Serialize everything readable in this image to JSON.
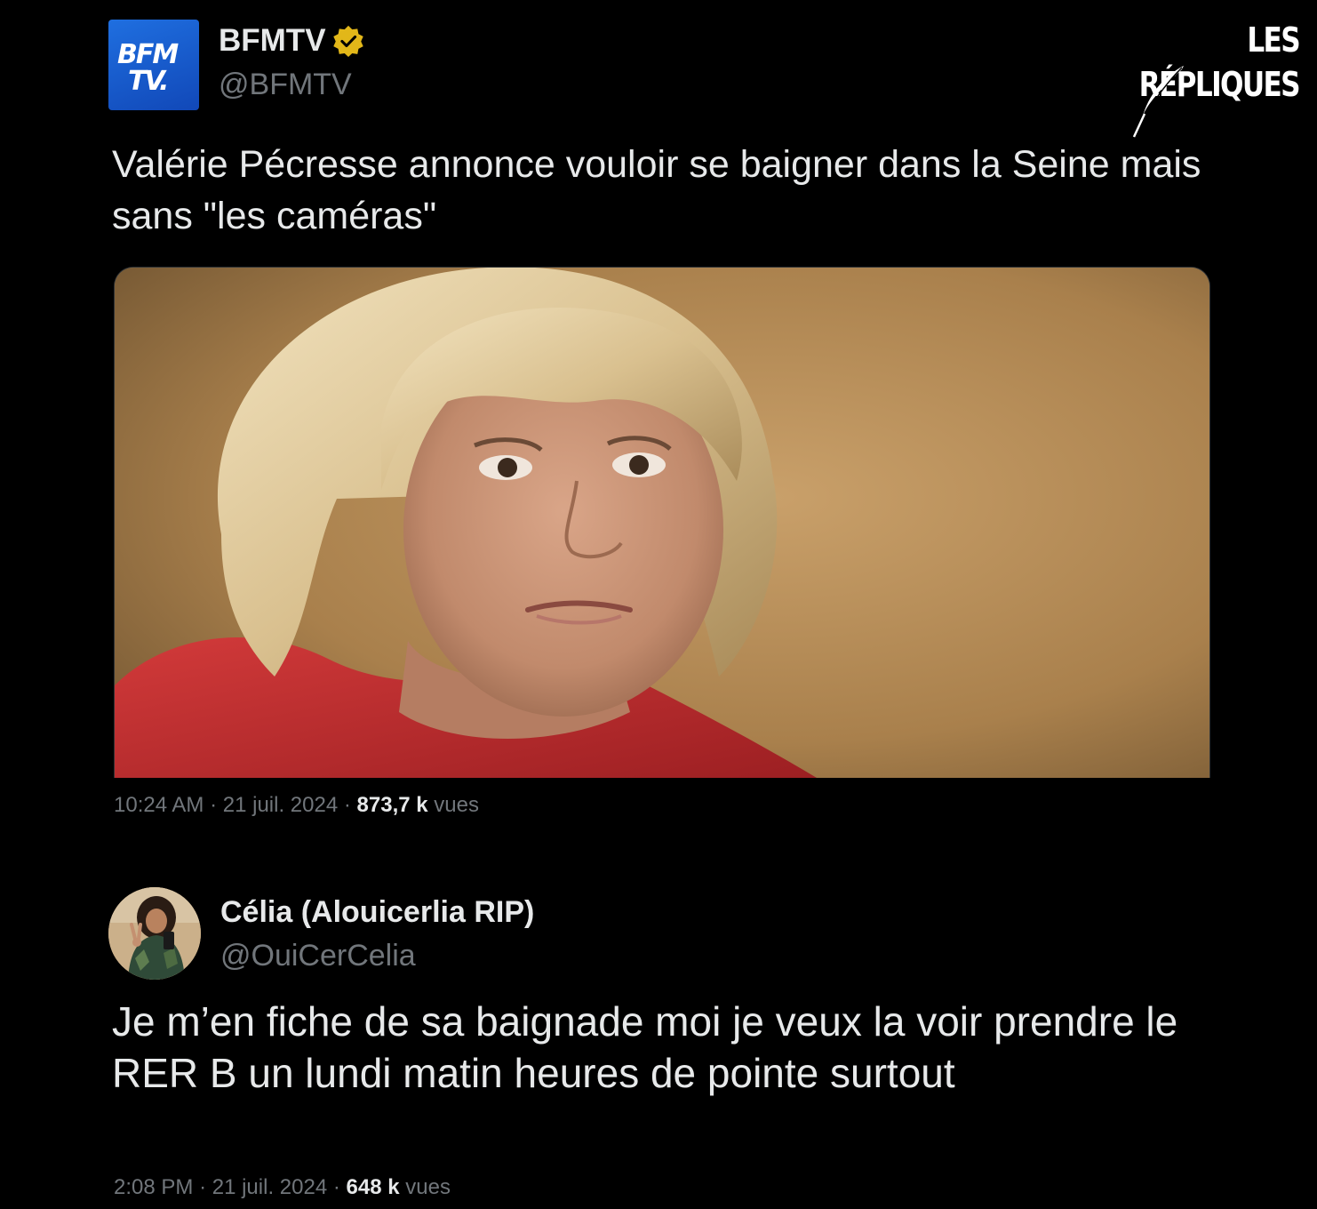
{
  "brand": {
    "name": "LES RÉPLIQUES",
    "logo_icon": "quill-icon"
  },
  "tweets": [
    {
      "avatar": {
        "icon": "bfmtv-logo",
        "line1": "BFM",
        "line2": "TV."
      },
      "display_name": "BFMTV",
      "verified_icon": "verified-gold-badge-icon",
      "handle": "@BFMTV",
      "text": "Valérie Pécresse annonce vouloir se baigner dans la Seine mais sans \"les caméras\"",
      "media_icon": "photo-portrait-woman-blonde-red-jacket",
      "time": "10:24 AM",
      "date": "21 juil. 2024",
      "views": "873,7 k",
      "views_label": "vues",
      "separator": "·"
    },
    {
      "avatar": {
        "icon": "profile-photo-selfie"
      },
      "display_name": "Célia (Alouicerlia RIP)",
      "handle": "@OuiCerCelia",
      "text": "Je m’en fiche de sa baignade moi je veux la voir prendre le RER B un lundi matin heures de pointe surtout",
      "time": "2:08 PM",
      "date": "21 juil. 2024",
      "views": "648 k",
      "views_label": "vues",
      "separator": "·"
    }
  ],
  "colors": {
    "background": "#000000",
    "primary_text": "#e7e9ea",
    "secondary_text": "#71767b",
    "bfm_blue": "#1a5fd4",
    "verified_gold": "#e2b719"
  }
}
